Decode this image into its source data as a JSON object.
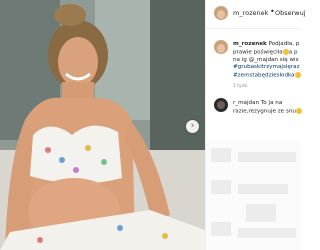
{
  "header": {
    "username": "m_rozenek",
    "separator": "•",
    "follow_label": "Obserwuj"
  },
  "caption": {
    "username": "m_rozenek",
    "line1": "Podjadła, p",
    "line2": "prawie poświęciła",
    "line2_suffix": "a p",
    "line3": "na ig @_majdan się wis",
    "line4": "#grubaskitrzymajsięraz",
    "line5": "#zemstabędziesłodka",
    "time": "1 tydz."
  },
  "comment2": {
    "username": "r_majdan",
    "line1_suffix": "To ja na",
    "line2": "razie,rezygnuje ze snu"
  },
  "icons": {
    "next": "chevron-right-icon",
    "emoji": "emoji-face-icon"
  },
  "colors": {
    "text": "#262626",
    "hashtag": "#00376b",
    "muted": "#8e8e8e"
  }
}
